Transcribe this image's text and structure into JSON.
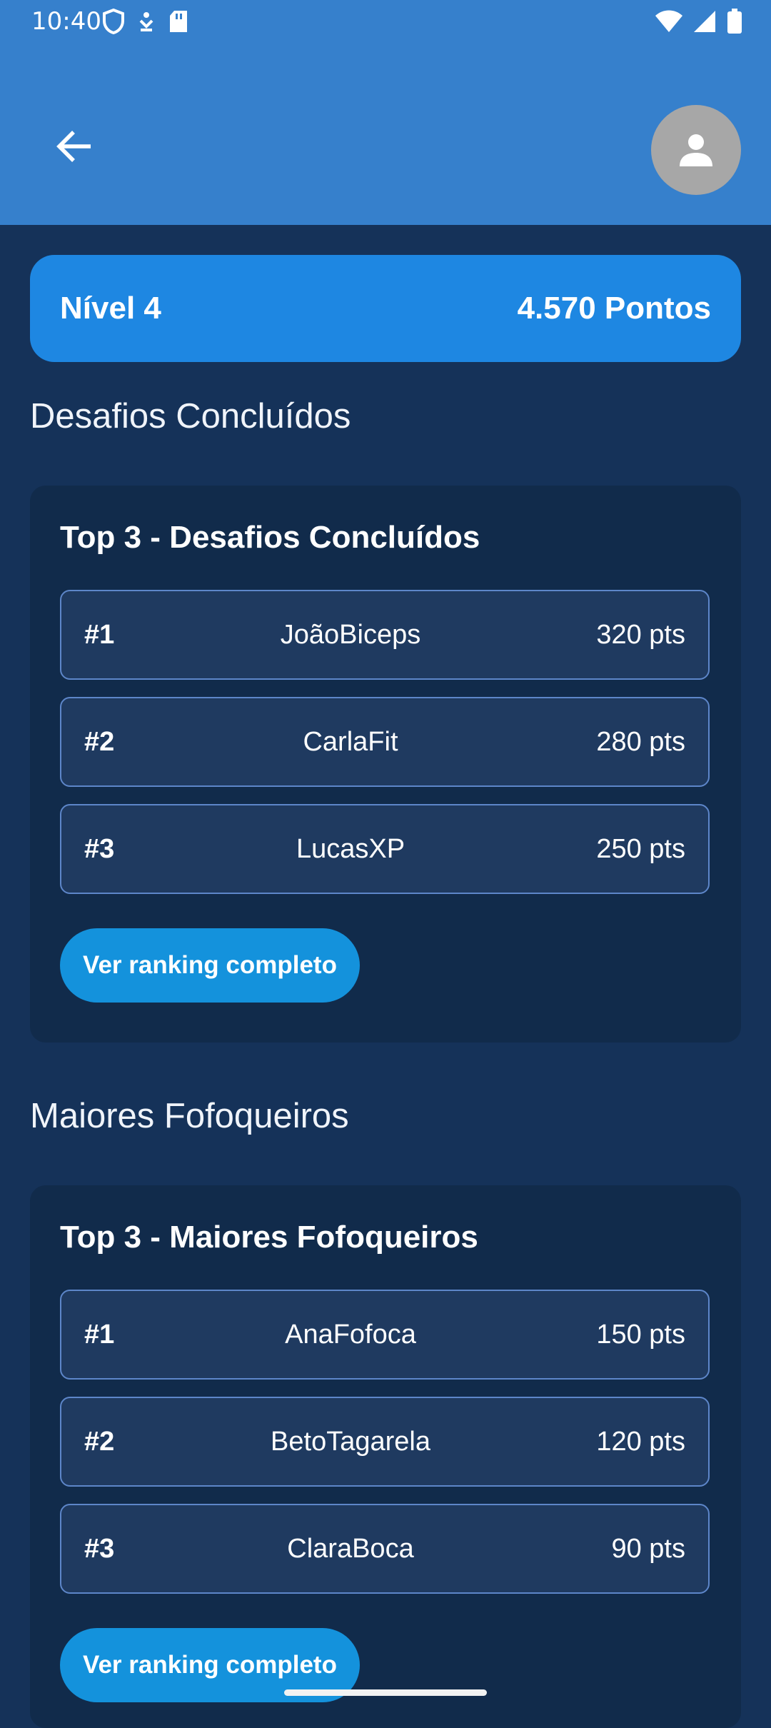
{
  "status_bar": {
    "time": "10:40"
  },
  "header": {
    "back_icon": "arrow-left-icon",
    "avatar_icon": "person-icon"
  },
  "level": {
    "label": "Nível 4",
    "points": "4.570 Pontos"
  },
  "sections": [
    {
      "heading": "Desafios Concluídos",
      "card_title": "Top 3 - Desafios Concluídos",
      "rows": [
        {
          "rank": "#1",
          "name": "JoãoBiceps",
          "points": "320 pts"
        },
        {
          "rank": "#2",
          "name": "CarlaFit",
          "points": "280 pts"
        },
        {
          "rank": "#3",
          "name": "LucasXP",
          "points": "250 pts"
        }
      ],
      "button": "Ver ranking completo"
    },
    {
      "heading": "Maiores Fofoqueiros",
      "card_title": "Top 3 - Maiores Fofoqueiros",
      "rows": [
        {
          "rank": "#1",
          "name": "AnaFofoca",
          "points": "150 pts"
        },
        {
          "rank": "#2",
          "name": "BetoTagarela",
          "points": "120 pts"
        },
        {
          "rank": "#3",
          "name": "ClaraBoca",
          "points": "90 pts"
        }
      ],
      "button": "Ver ranking completo"
    }
  ],
  "colors": {
    "appbar": "#3680cc",
    "background": "#153259",
    "level_card": "#1e87e2",
    "button": "#1492dc"
  }
}
